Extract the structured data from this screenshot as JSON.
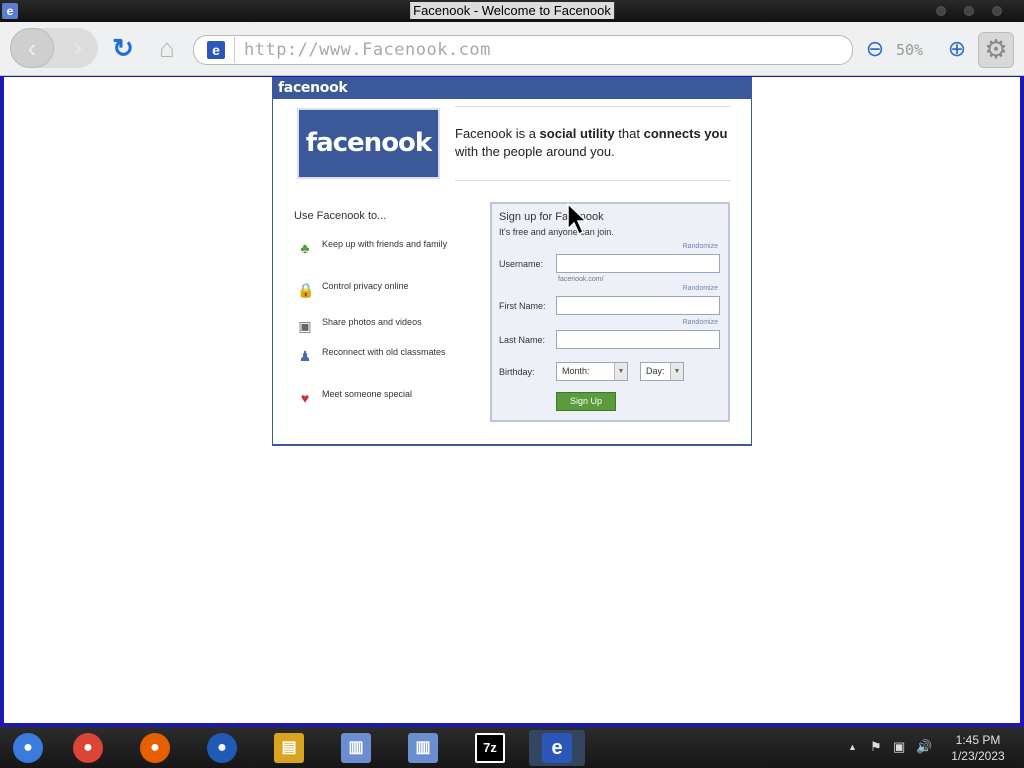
{
  "window": {
    "title": "Facenook - Welcome to Facenook",
    "app_icon": "e"
  },
  "browser": {
    "back_icon": "‹",
    "forward_icon": "›",
    "reload_icon": "↻",
    "home_icon": "⌂",
    "url_icon": "e",
    "url": "http://www.Facenook.com",
    "zoom_out_icon": "⊖",
    "zoom_level": "50%",
    "zoom_in_icon": "⊕",
    "settings_icon": "⚙"
  },
  "page": {
    "header_logo": "facenook",
    "logo": "facenook",
    "tagline": {
      "part1": "Facenook is a ",
      "bold1": "social utility",
      "part2": " that ",
      "bold2": "connects you",
      "part3": " with the people around you."
    },
    "use_title": "Use Facenook to...",
    "features": [
      {
        "icon": "♣",
        "label": "Keep up with friends and family",
        "color": "#5b9a3d"
      },
      {
        "icon": "🔒",
        "label": "Control privacy online",
        "color": "#c89b2a"
      },
      {
        "icon": "▣",
        "label": "Share photos and videos",
        "color": "#666666"
      },
      {
        "icon": "♟",
        "label": "Reconnect with old classmates",
        "color": "#4a6ca8"
      },
      {
        "icon": "♥",
        "label": "Meet someone special",
        "color": "#c8323c"
      }
    ],
    "signup": {
      "title": "Sign up for Facenook",
      "subtitle": "It's free and anyone can join.",
      "randomize": "Randomize",
      "username_label": "Username:",
      "username_value": "",
      "username_hint": "facenook.com/",
      "first_name_label": "First Name:",
      "first_name_value": "",
      "last_name_label": "Last Name:",
      "last_name_value": "",
      "birthday_label": "Birthday:",
      "month_value": "Month:",
      "day_value": "Day:",
      "submit_label": "Sign Up"
    }
  },
  "taskbar": {
    "apps": [
      {
        "name": "chromium",
        "glyph": "●",
        "color": "#3a7be0"
      },
      {
        "name": "chrome",
        "glyph": "●",
        "color": "#db4437"
      },
      {
        "name": "firefox",
        "glyph": "●",
        "color": "#e66000"
      },
      {
        "name": "obama",
        "glyph": "●",
        "color": "#1f5bb4"
      },
      {
        "name": "files",
        "glyph": "▤",
        "color": "#d9a520"
      },
      {
        "name": "installer1",
        "glyph": "▥",
        "color": "#6b8ed0"
      },
      {
        "name": "installer2",
        "glyph": "▥",
        "color": "#6b8ed0"
      },
      {
        "name": "7zip",
        "glyph": "7z",
        "color": "#000000"
      },
      {
        "name": "browser-e",
        "glyph": "e",
        "color": "#2c56b7"
      }
    ],
    "tray_icons": [
      "▲",
      "⚑",
      "▣",
      "🔊"
    ],
    "time": "1:45 PM",
    "date": "1/23/2023"
  },
  "colors": {
    "brand": "#3b5998",
    "signup_button": "#5b9a3d",
    "desktop": "#1b18b5"
  }
}
